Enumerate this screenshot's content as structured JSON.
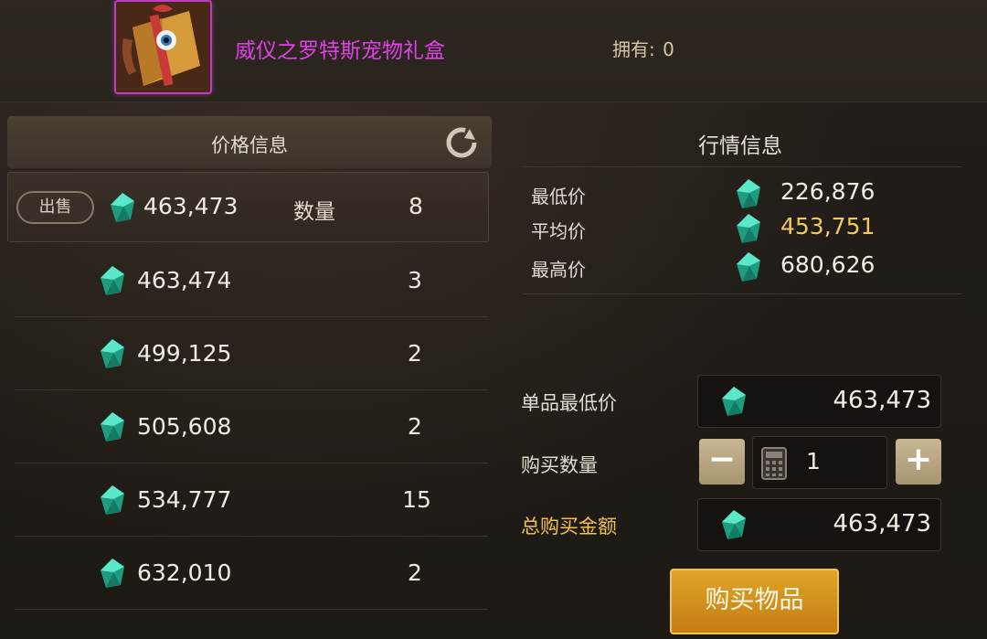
{
  "header": {
    "item_name": "威仪之罗特斯宠物礼盒",
    "own_label": "拥有",
    "own_value": "0"
  },
  "price_panel": {
    "title": "价格信息",
    "sell_button": "出售",
    "qty_label": "数量",
    "rows": [
      {
        "price": "463,473",
        "qty": "8"
      },
      {
        "price": "463,474",
        "qty": "3"
      },
      {
        "price": "499,125",
        "qty": "2"
      },
      {
        "price": "505,608",
        "qty": "2"
      },
      {
        "price": "534,777",
        "qty": "15"
      },
      {
        "price": "632,010",
        "qty": "2"
      }
    ]
  },
  "market": {
    "title": "行情信息",
    "min_label": "最低价",
    "min_value": "226,876",
    "avg_label": "平均价",
    "avg_value": "453,751",
    "max_label": "最高价",
    "max_value": "680,626"
  },
  "purchase": {
    "unit_min_label": "单品最低价",
    "unit_min_value": "463,473",
    "qty_label": "购买数量",
    "qty_value": "1",
    "total_label": "总购买金额",
    "total_value": "463,473",
    "buy_button": "购买物品",
    "minus_symbol": "−",
    "plus_symbol": "+"
  },
  "colors": {
    "item_name": "#e040e8",
    "gold_text": "#f2c24c",
    "avg_price": "#f2c95c",
    "buy_button": "#d4901e",
    "gem": "#2fd0a8"
  },
  "icons": {
    "item": "gift-box-icon",
    "currency": "gem-icon",
    "refresh": "refresh-icon",
    "calculator": "calculator-icon"
  }
}
